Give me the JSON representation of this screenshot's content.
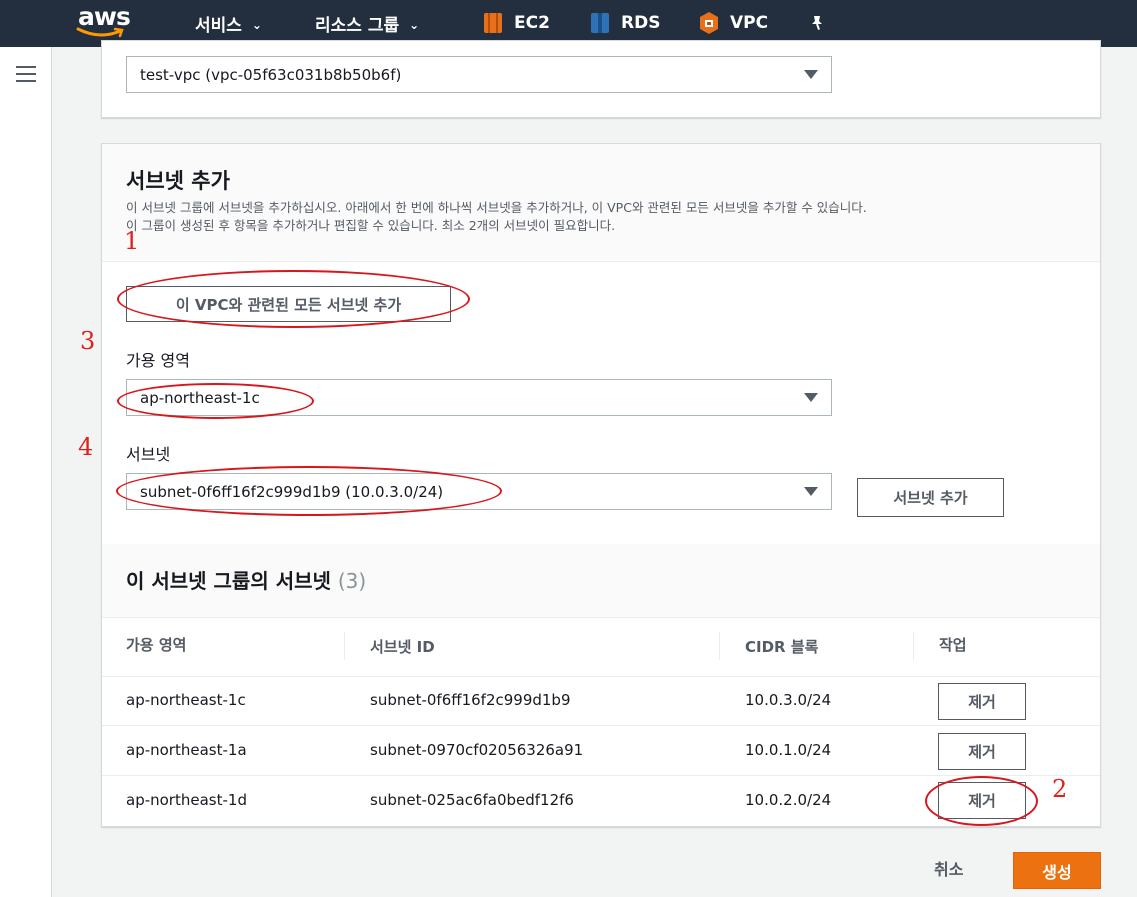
{
  "nav": {
    "brand": "aws",
    "services": "서비스",
    "resource_groups": "리소스 그룹",
    "shortcuts": [
      "EC2",
      "RDS",
      "VPC"
    ]
  },
  "vpc_select": {
    "value": "test-vpc (vpc-05f63c031b8b50b6f)"
  },
  "add_subnets": {
    "title": "서브넷 추가",
    "desc_line1": "이 서브넷 그룹에 서브넷을 추가하십시오. 아래에서 한 번에 하나씩 서브넷을 추가하거나, 이 VPC와 관련된 모든 서브넷을 추가할 수 있습니다.",
    "desc_line2": "이 그룹이 생성된 후 항목을 추가하거나 편집할 수 있습니다. 최소 2개의 서브넷이 필요합니다.",
    "add_all_button": "이 VPC와 관련된 모든 서브넷 추가",
    "az_label": "가용 영역",
    "az_value": "ap-northeast-1c",
    "subnet_label": "서브넷",
    "subnet_value": "subnet-0f6ff16f2c999d1b9 (10.0.3.0/24)",
    "add_subnet_button": "서브넷 추가"
  },
  "subnet_table": {
    "title": "이 서브넷 그룹의 서브넷",
    "count": "(3)",
    "columns": [
      "가용 영역",
      "서브넷 ID",
      "CIDR 블록",
      "작업"
    ],
    "rows": [
      {
        "az": "ap-northeast-1c",
        "subnet_id": "subnet-0f6ff16f2c999d1b9",
        "cidr": "10.0.3.0/24",
        "action": "제거"
      },
      {
        "az": "ap-northeast-1a",
        "subnet_id": "subnet-0970cf02056326a91",
        "cidr": "10.0.1.0/24",
        "action": "제거"
      },
      {
        "az": "ap-northeast-1d",
        "subnet_id": "subnet-025ac6fa0bedf12f6",
        "cidr": "10.0.2.0/24",
        "action": "제거"
      }
    ]
  },
  "footer": {
    "cancel": "취소",
    "create": "생성"
  },
  "annotations": [
    "1",
    "2",
    "3",
    "4"
  ],
  "colors": {
    "nav_bg": "#232f3e",
    "primary": "#ec7211",
    "annotation": "#d8161b"
  }
}
